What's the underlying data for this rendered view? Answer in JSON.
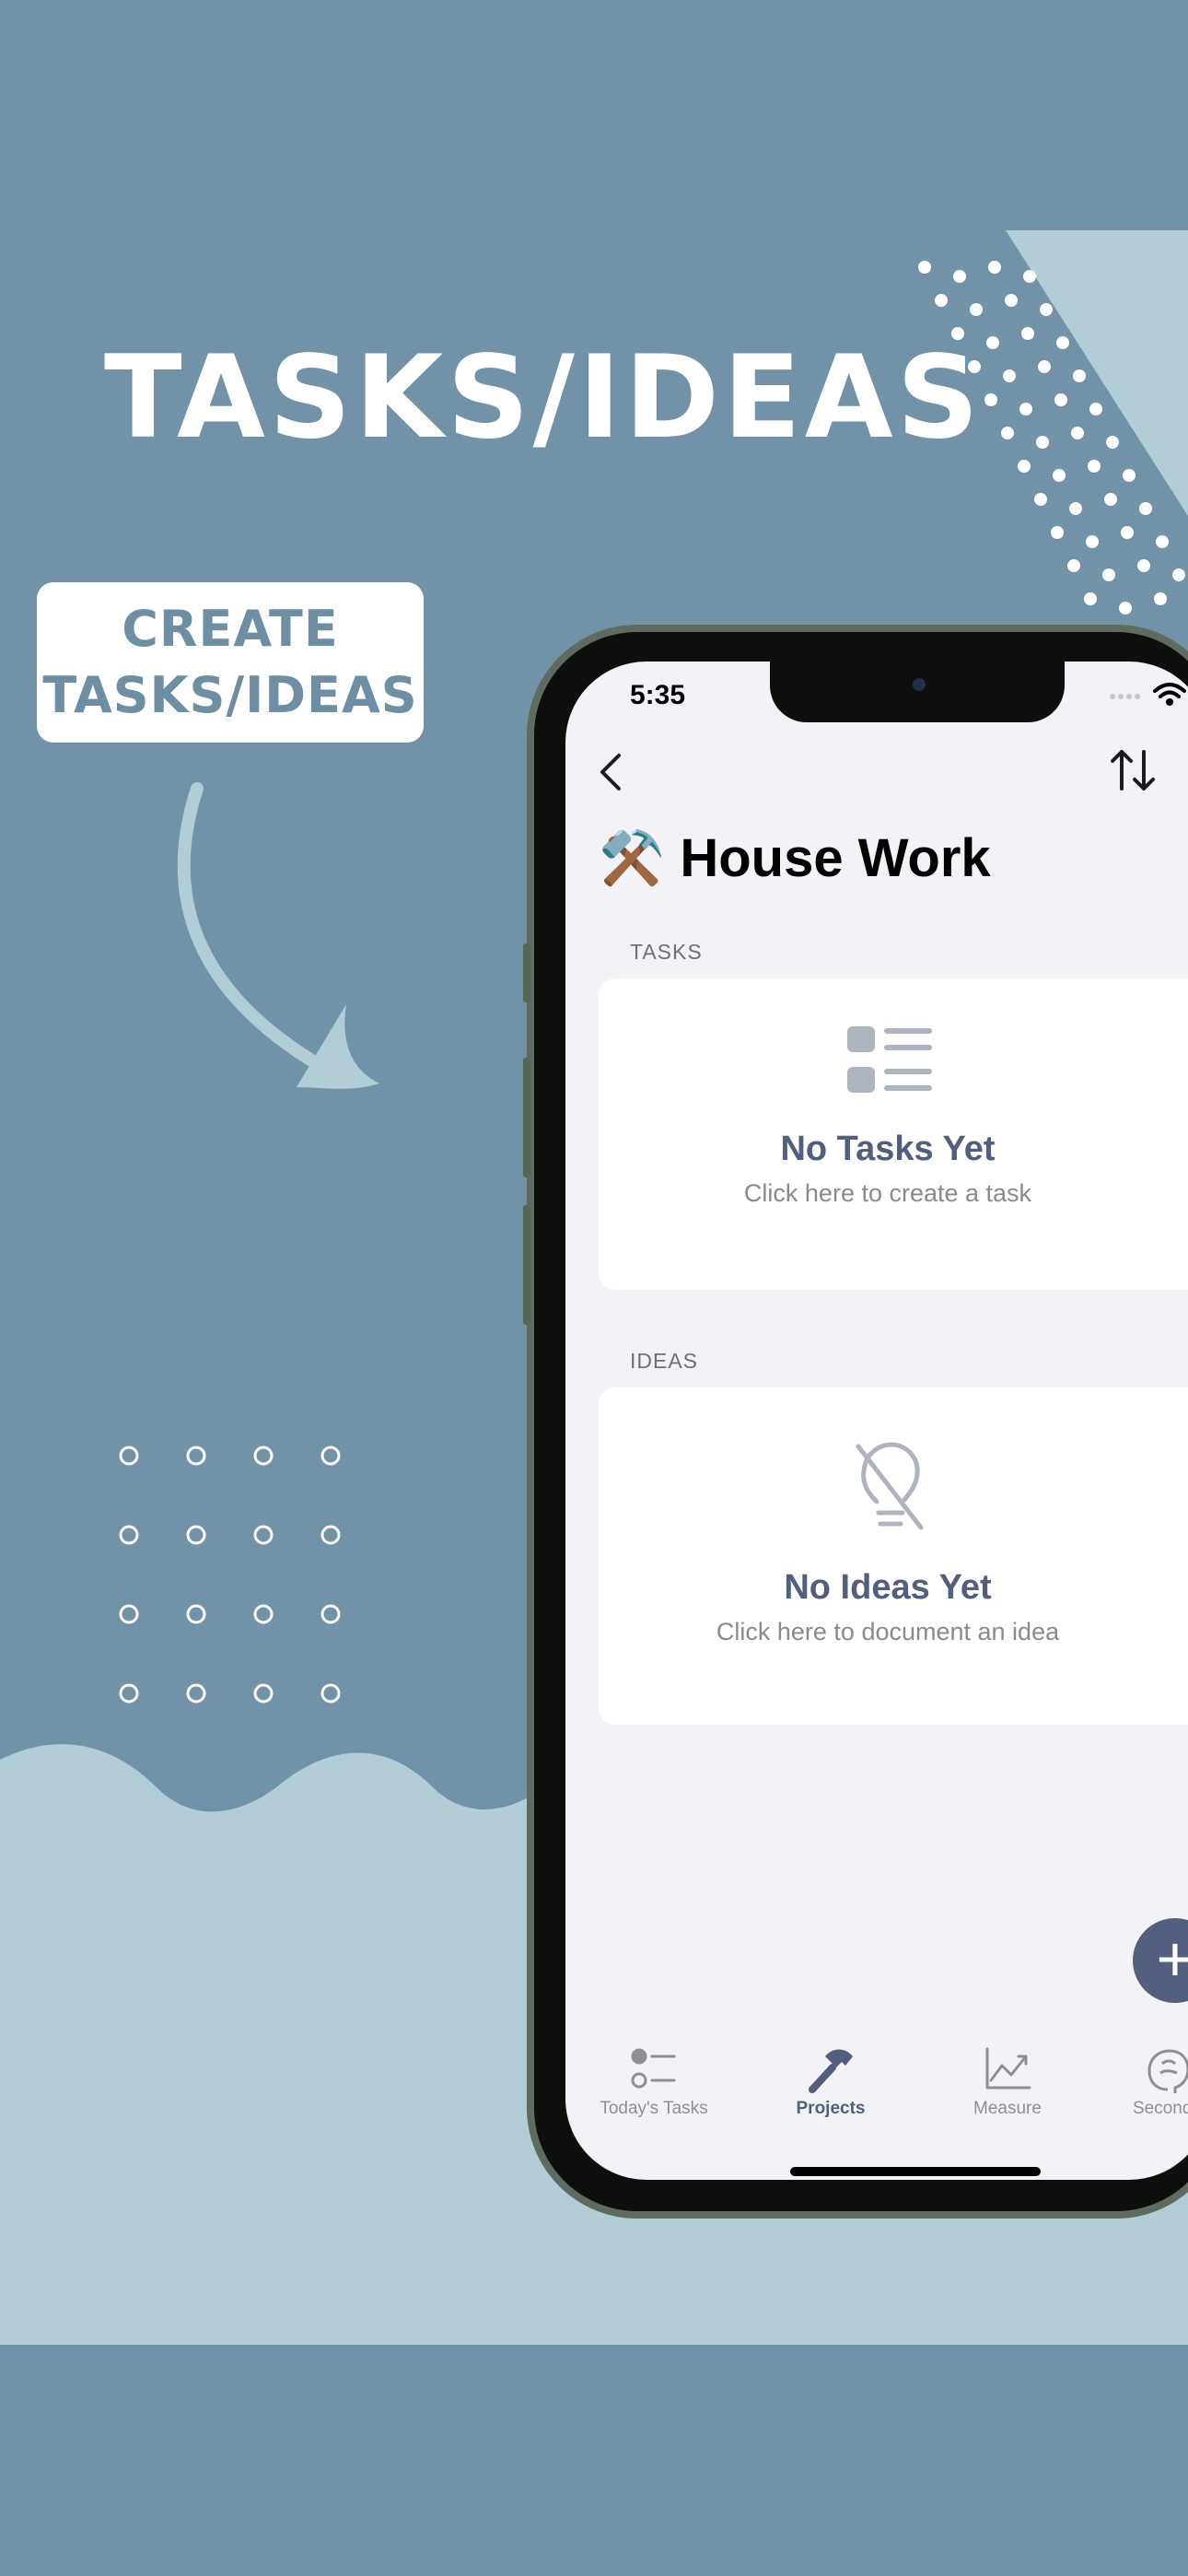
{
  "promo": {
    "headline": "TASKS/IDEAS",
    "label": "CREATE\nTASKS/IDEAS"
  },
  "colors": {
    "background": "#7293a7",
    "wave": "#b3cdd7",
    "accent": "#525e7d",
    "screen_bg": "#f2f2f7"
  },
  "status_bar": {
    "time": "5:35",
    "icons": [
      "cellular-dots-icon",
      "wifi-icon"
    ]
  },
  "nav": {
    "back_icon": "chevron-left-icon",
    "sort_icon": "sort-arrows-icon"
  },
  "project": {
    "emoji": "⚒️",
    "title": "House Work"
  },
  "tasks": {
    "section_label": "TASKS",
    "icon": "list-icon",
    "empty_title": "No Tasks Yet",
    "empty_subtitle": "Click here to create a task"
  },
  "ideas": {
    "section_label": "IDEAS",
    "icon": "lightbulb-slash-icon",
    "empty_title": "No Ideas Yet",
    "empty_subtitle": "Click here to document an idea"
  },
  "fab": {
    "label": "+"
  },
  "tab_bar": {
    "items": [
      {
        "label": "Today's Tasks",
        "icon": "checklist-icon",
        "active": false
      },
      {
        "label": "Projects",
        "icon": "hammer-icon",
        "active": true
      },
      {
        "label": "Measure",
        "icon": "chart-icon",
        "active": false
      },
      {
        "label": "Second",
        "icon": "brain-icon",
        "active": false
      }
    ]
  }
}
